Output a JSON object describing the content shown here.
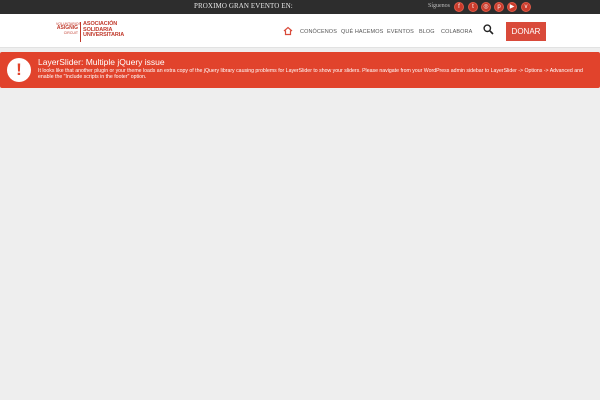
{
  "topbar": {
    "event_text": "PROXIMO GRAN EVENTO EN:",
    "follow_label": "Síguenos",
    "social_icons": [
      "facebook-icon",
      "twitter-icon",
      "instagram-icon",
      "pinterest-icon",
      "youtube-icon",
      "vimeo-icon"
    ],
    "social_glyphs": [
      "f",
      "t",
      "◎",
      "p",
      "▶",
      "v"
    ]
  },
  "logo": {
    "line1": "VOLUNTARIOS",
    "line2": "ASIGNIG",
    "line3": "CIRCUIT",
    "name_line1": "ASOCIACIÓN",
    "name_line2": "SOLIDARIA",
    "name_line3": "UNIVERSITARIA"
  },
  "nav": {
    "items": [
      "CONÓCENOS",
      "QUÉ HACEMOS",
      "EVENTOS",
      "BLOG",
      "COLABORA"
    ],
    "donate": "DONAR"
  },
  "alert": {
    "title": "LayerSlider: Multiple jQuery issue",
    "body": "It looks like that another plugin or your theme loads an extra copy of the jQuery library causing problems for LayerSlider to show your sliders. Please navigate from your WordPress admin sidebar to LayerSlider -> Options -> Advanced and enable the \"Include scripts in the footer\" option."
  },
  "colors": {
    "accent": "#d94a3a",
    "alert_bg": "#e1432c",
    "topbar_bg": "#2d2d2d",
    "page_bg": "#eeeeee"
  }
}
